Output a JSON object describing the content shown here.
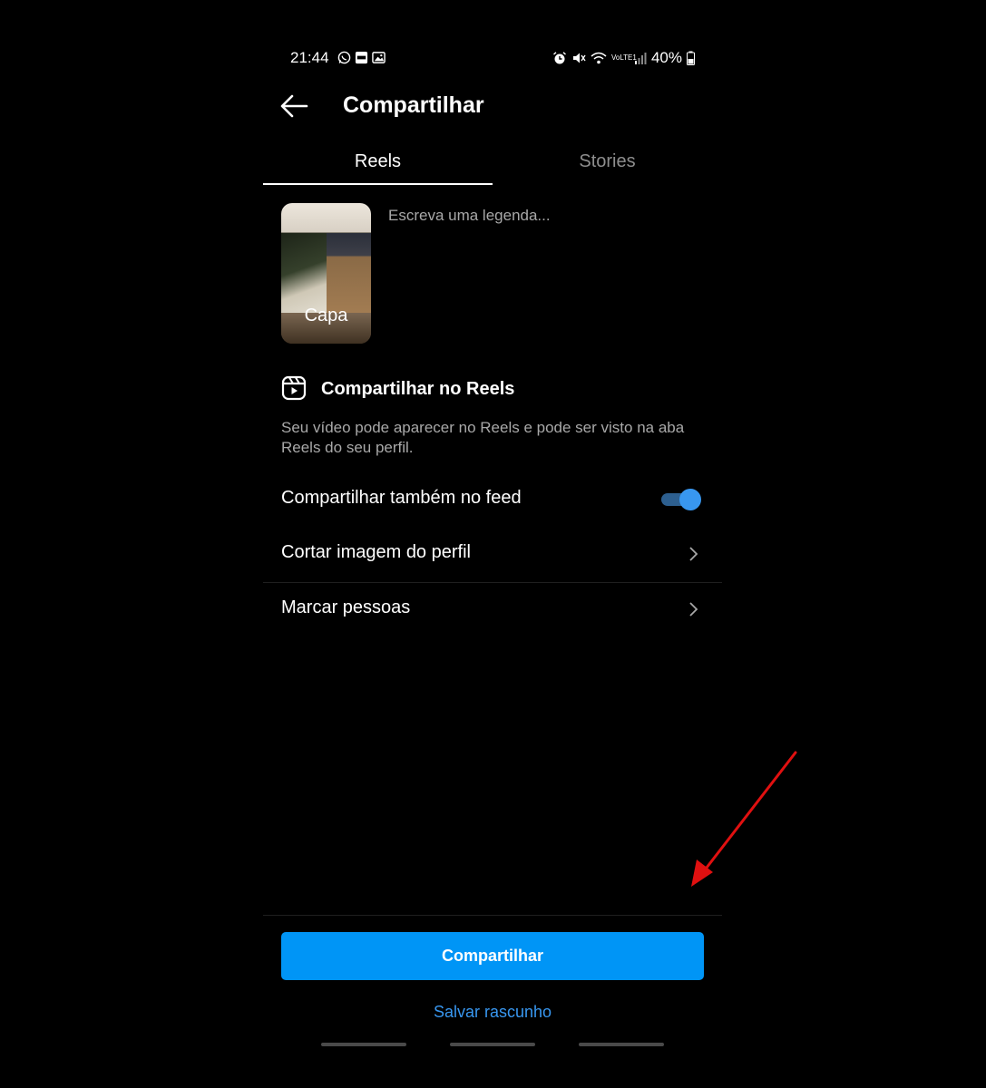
{
  "status_bar": {
    "time": "21:44",
    "battery": "40%",
    "network_label": "VoLTE1",
    "left_icons": [
      "whatsapp-icon",
      "inter-app-icon",
      "gallery-icon"
    ],
    "right_icons": [
      "alarm-icon",
      "mute-icon",
      "wifi-icon",
      "signal-icon",
      "battery-icon"
    ]
  },
  "header": {
    "title": "Compartilhar",
    "back_icon": "arrow-left-icon"
  },
  "tabs": [
    {
      "label": "Reels",
      "active": true
    },
    {
      "label": "Stories",
      "active": false
    }
  ],
  "media": {
    "cover_label": "Capa",
    "caption_placeholder": "Escreva uma legenda..."
  },
  "reels_section": {
    "icon": "reels-icon",
    "title": "Compartilhar no Reels",
    "description": "Seu vídeo pode aparecer no Reels e pode ser visto na aba Reels do seu perfil."
  },
  "options": {
    "feed_label": "Compartilhar também no feed",
    "feed_enabled": true,
    "crop_label": "Cortar imagem do perfil",
    "tag_label": "Marcar pessoas"
  },
  "actions": {
    "share_label": "Compartilhar",
    "draft_label": "Salvar rascunho"
  },
  "colors": {
    "background": "#000000",
    "primary_button": "#0095f6",
    "link": "#3897f0",
    "secondary_text": "#a8a8a8",
    "annotation_arrow": "#e01010"
  }
}
